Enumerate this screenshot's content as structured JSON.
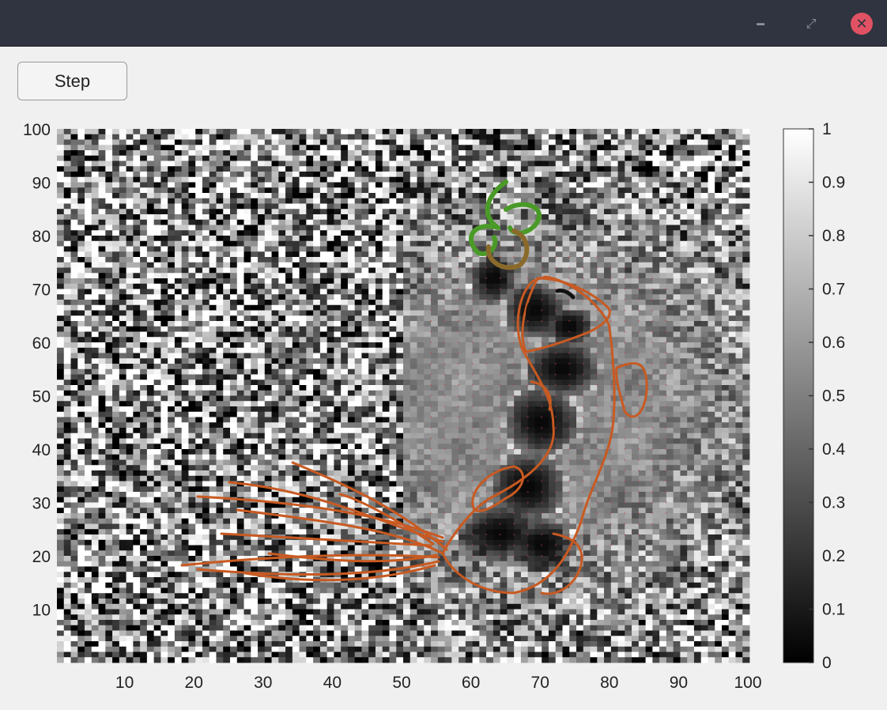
{
  "window": {
    "minimize_icon": "minimize-icon",
    "maximize_icon": "maximize-icon",
    "close_icon": "close-icon"
  },
  "toolbar": {
    "step_label": "Step"
  },
  "chart_data": {
    "type": "heatmap",
    "title": "",
    "xlabel": "",
    "ylabel": "",
    "colormap": "gray",
    "xlim": [
      0,
      100
    ],
    "ylim": [
      0,
      100
    ],
    "xticks": [
      "10",
      "20",
      "30",
      "40",
      "50",
      "60",
      "70",
      "80",
      "90",
      "100"
    ],
    "yticks": [
      "10",
      "20",
      "30",
      "40",
      "50",
      "60",
      "70",
      "80",
      "90",
      "100"
    ],
    "colorbar": {
      "range": [
        0,
        1
      ],
      "ticks": [
        "0",
        "0.1",
        "0.2",
        "0.3",
        "0.4",
        "0.5",
        "0.6",
        "0.7",
        "0.8",
        "0.9",
        "1"
      ]
    },
    "overlay": "koi-fish-drawing",
    "colors": {
      "fish": "#c85a22",
      "leaf": "#4a9a28",
      "ring": "#8a6a2a",
      "vectors": "#d04040"
    }
  }
}
